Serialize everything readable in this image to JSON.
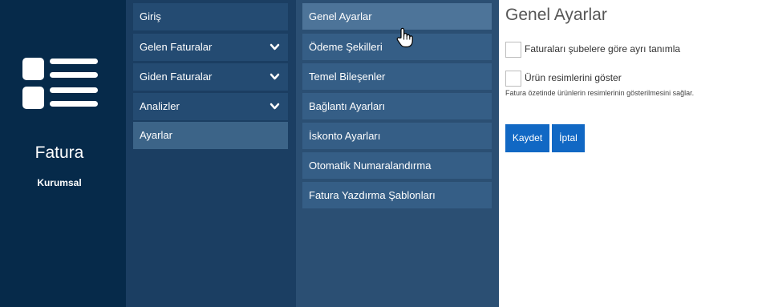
{
  "brand": {
    "title": "Fatura",
    "subtitle": "Kurumsal",
    "logo_icon": "list-icon"
  },
  "nav_primary": {
    "items": [
      {
        "label": "Giriş",
        "expandable": false,
        "active": false
      },
      {
        "label": "Gelen Faturalar",
        "expandable": true,
        "active": false
      },
      {
        "label": "Giden Faturalar",
        "expandable": true,
        "active": false
      },
      {
        "label": "Analizler",
        "expandable": true,
        "active": false
      },
      {
        "label": "Ayarlar",
        "expandable": false,
        "active": true
      }
    ]
  },
  "nav_secondary": {
    "items": [
      {
        "label": "Genel Ayarlar",
        "active": true
      },
      {
        "label": "Ödeme Şekilleri",
        "active": false
      },
      {
        "label": "Temel Bileşenler",
        "active": false
      },
      {
        "label": "Bağlantı Ayarları",
        "active": false
      },
      {
        "label": "İskonto Ayarları",
        "active": false
      },
      {
        "label": "Otomatik Numaralandırma",
        "active": false
      },
      {
        "label": "Fatura Yazdırma Şablonları",
        "active": false
      }
    ]
  },
  "main": {
    "title": "Genel Ayarlar",
    "options": [
      {
        "label": "Faturaları şubelere göre ayrı tanımla",
        "checked": false
      },
      {
        "label": "Ürün resimlerini göster",
        "checked": false,
        "help": "Fatura özetinde ürünlerin resimlerinin gösterilmesini sağlar."
      }
    ],
    "save_label": "Kaydet",
    "cancel_label": "İptal"
  },
  "colors": {
    "brand_bg": "#062a4a",
    "nav_primary_bg": "#1b3e62",
    "nav_secondary_bg": "#2b4f73",
    "button_blue": "#1168c4"
  }
}
